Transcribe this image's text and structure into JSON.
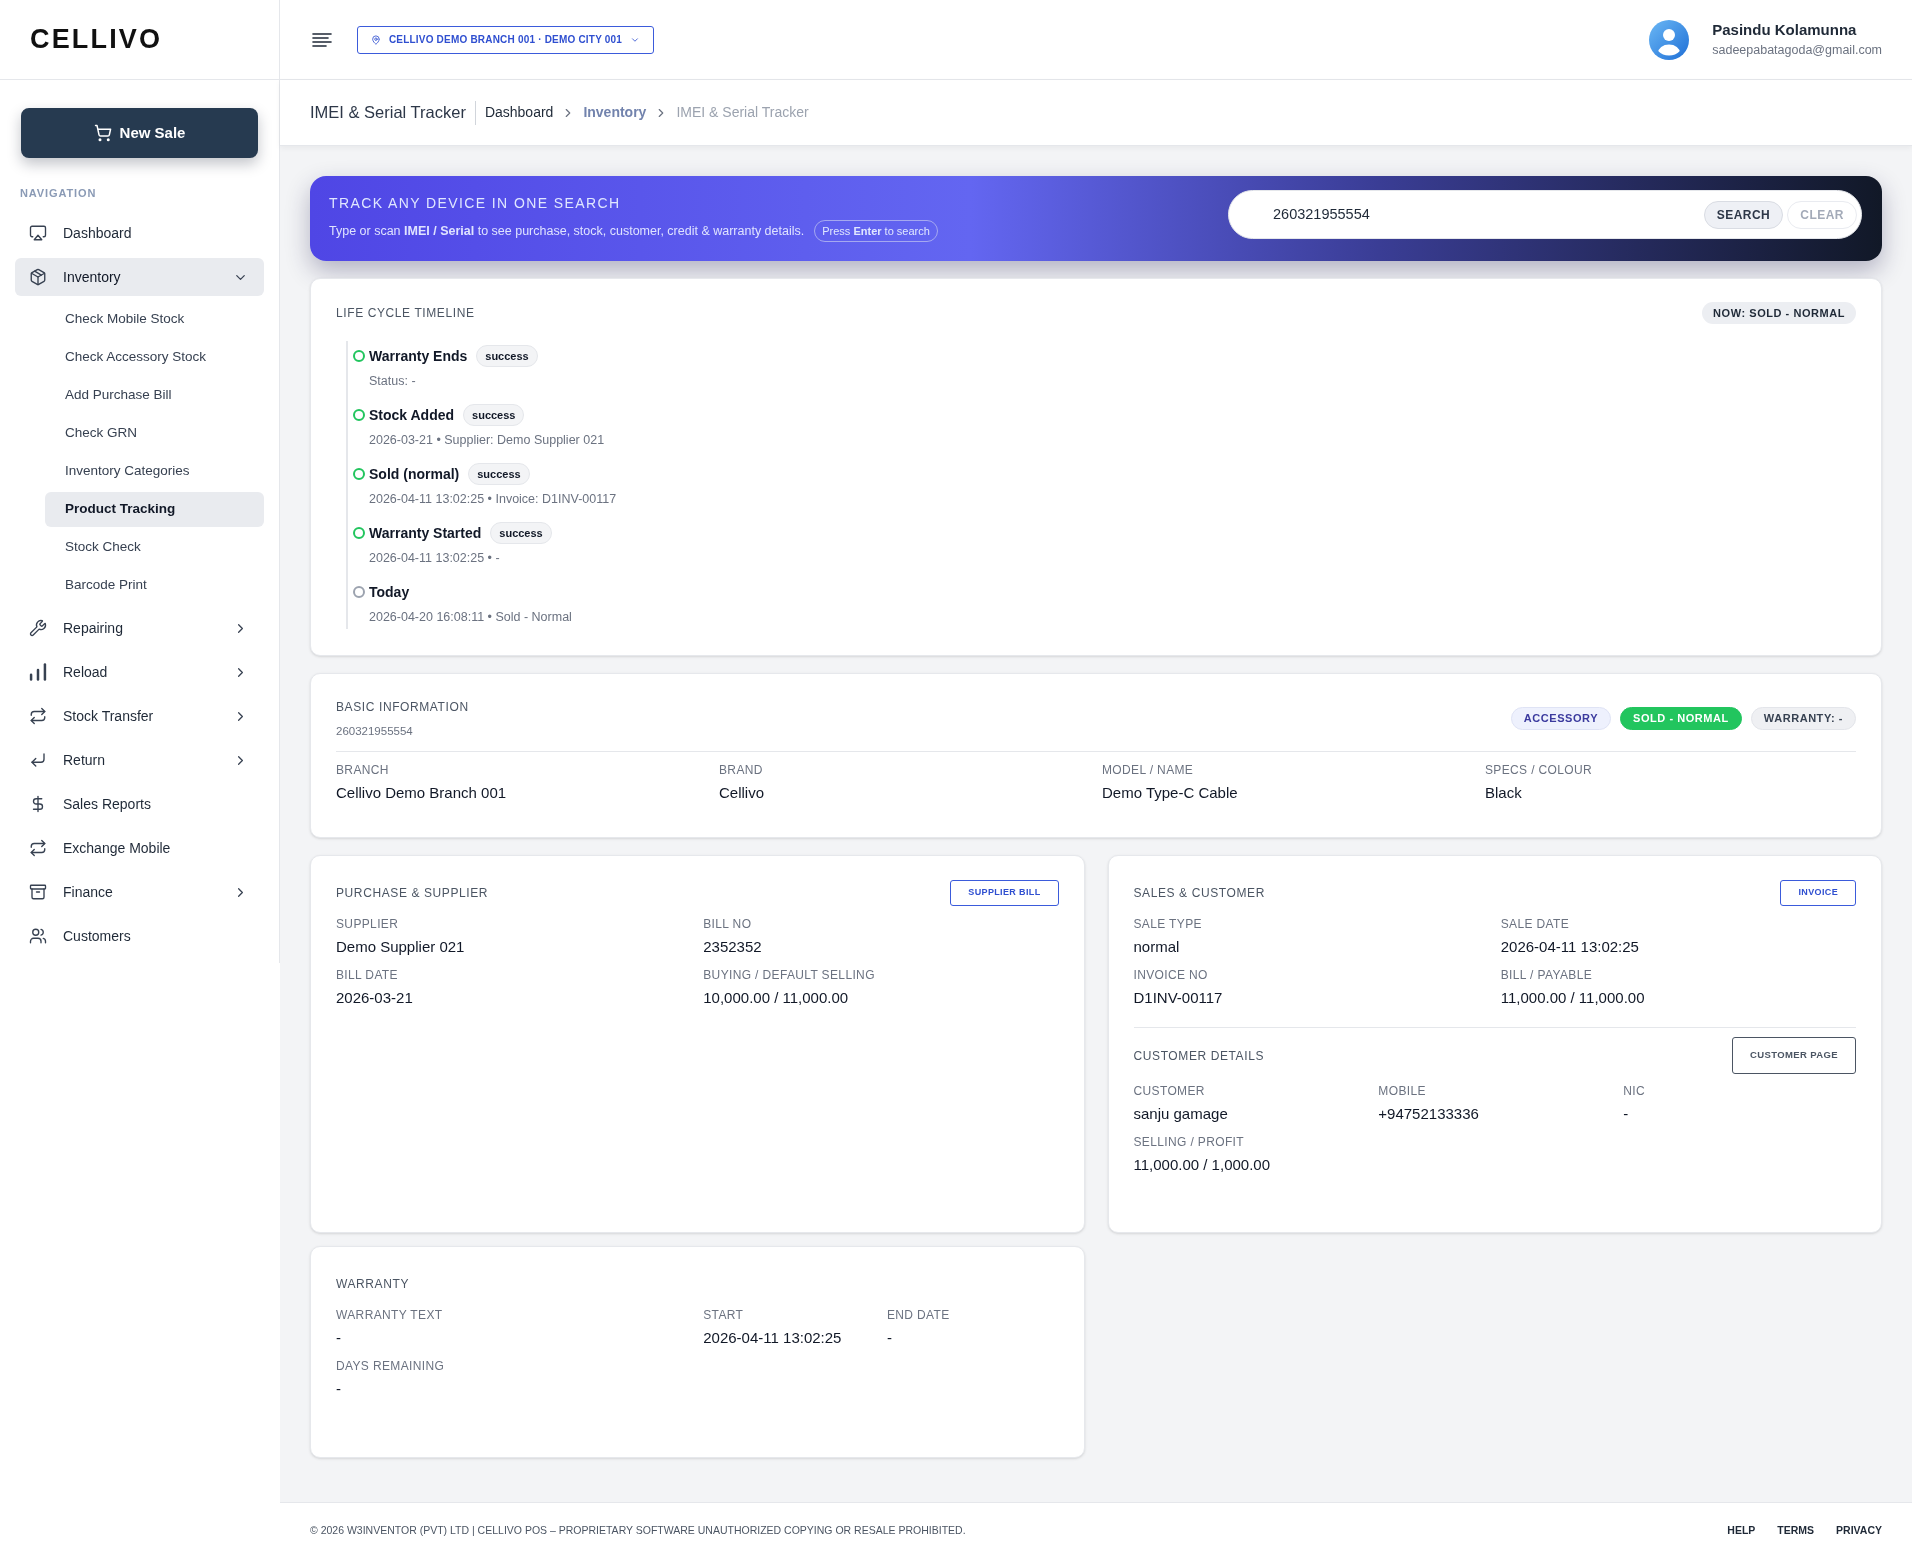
{
  "sidebar": {
    "logo": "CELLIVO",
    "new_sale": "New Sale",
    "section_label": "NAVIGATION",
    "items": [
      {
        "label": "Dashboard",
        "selected": false
      },
      {
        "label": "Inventory",
        "selected": true,
        "expanded": true,
        "children": [
          {
            "label": "Check Mobile Stock",
            "selected": false
          },
          {
            "label": "Check Accessory Stock",
            "selected": false
          },
          {
            "label": "Add Purchase Bill",
            "selected": false
          },
          {
            "label": "Check GRN",
            "selected": false
          },
          {
            "label": "Inventory Categories",
            "selected": false
          },
          {
            "label": "Product Tracking",
            "selected": true
          },
          {
            "label": "Stock Check",
            "selected": false
          },
          {
            "label": "Barcode Print",
            "selected": false
          }
        ]
      },
      {
        "label": "Repairing",
        "selected": false,
        "expanded": false
      },
      {
        "label": "Reload",
        "selected": false,
        "expanded": false
      },
      {
        "label": "Stock Transfer",
        "selected": false,
        "expanded": false
      },
      {
        "label": "Return",
        "selected": false,
        "expanded": false
      },
      {
        "label": "Sales Reports",
        "selected": false
      },
      {
        "label": "Exchange Mobile",
        "selected": false
      },
      {
        "label": "Finance",
        "selected": false,
        "expanded": false
      },
      {
        "label": "Customers",
        "selected": false
      }
    ]
  },
  "topbar": {
    "branch": "CELLIVO DEMO BRANCH 001 · DEMO CITY 001",
    "user": {
      "name": "Pasindu Kolamunna",
      "email": "sadeepabatagoda@gmail.com"
    }
  },
  "breadcrumb": {
    "title": "IMEI & Serial Tracker",
    "path": [
      "Dashboard",
      "Inventory",
      "IMEI & Serial Tracker"
    ]
  },
  "search_banner": {
    "title": "TRACK ANY DEVICE IN ONE SEARCH",
    "subtitle": "Type or scan **IMEI / Serial** to see purchase, stock, customer, credit & warranty details.",
    "hint": "Press **Enter** to search",
    "search": {
      "value": "260321955554"
    },
    "buttons": [
      {
        "label": "SEARCH",
        "disabled": false
      },
      {
        "label": "CLEAR",
        "disabled": true
      }
    ]
  },
  "timeline": {
    "title": "LIFE CYCLE TIMELINE",
    "now": "NOW: SOLD - NORMAL",
    "events": [
      {
        "title": "Warranty Ends",
        "badge": "success",
        "detail": "Status: -",
        "color": "#22c55e"
      },
      {
        "title": "Stock Added",
        "badge": "success",
        "detail": "2026-03-21 • Supplier: Demo Supplier 021",
        "color": "#22c55e"
      },
      {
        "title": "Sold (normal)",
        "badge": "success",
        "detail": "2026-04-11 13:02:25 • Invoice: D1INV-00117",
        "color": "#22c55e"
      },
      {
        "title": "Warranty Started",
        "badge": "success",
        "detail": "2026-04-11 13:02:25 • -",
        "color": "#22c55e"
      },
      {
        "title": "Today",
        "detail": "2026-04-20 16:08:11 • Sold - Normal",
        "color": "#9ca3af"
      }
    ]
  },
  "basic_info": {
    "title": "BASIC INFORMATION",
    "imei": "260321955554",
    "tags": [
      {
        "label": "ACCESSORY",
        "kind": "category"
      },
      {
        "label": "SOLD - NORMAL",
        "kind": "status"
      },
      {
        "label": "WARRANTY: -",
        "kind": "warranty"
      }
    ],
    "fields": [
      {
        "label": "BRANCH",
        "value": "Cellivo Demo Branch 001"
      },
      {
        "label": "BRAND",
        "value": "Cellivo"
      },
      {
        "label": "MODEL / NAME",
        "value": "Demo Type-C Cable"
      },
      {
        "label": "SPECS / COLOUR",
        "value": "Black"
      }
    ]
  },
  "purchase": {
    "title": "PURCHASE & SUPPLIER",
    "button": "SUPPLIER BILL",
    "fields": [
      {
        "label": "SUPPLIER",
        "value": "Demo Supplier 021"
      },
      {
        "label": "BILL NO",
        "value": "2352352"
      },
      {
        "label": "BILL DATE",
        "value": "2026-03-21"
      },
      {
        "label": "BUYING / DEFAULT SELLING",
        "value": "10,000.00 / 11,000.00"
      }
    ]
  },
  "sales": {
    "title": "SALES & CUSTOMER",
    "button": "INVOICE",
    "fields": [
      {
        "label": "SALE TYPE",
        "value": "normal"
      },
      {
        "label": "SALE DATE",
        "value": "2026-04-11 13:02:25"
      },
      {
        "label": "INVOICE NO",
        "value": "D1INV-00117"
      },
      {
        "label": "BILL / PAYABLE",
        "value": "11,000.00 / 11,000.00"
      }
    ],
    "customer": {
      "title": "CUSTOMER DETAILS",
      "button": "CUSTOMER PAGE",
      "fields": [
        {
          "label": "CUSTOMER",
          "value": "sanju gamage"
        },
        {
          "label": "MOBILE",
          "value": "+94752133336"
        },
        {
          "label": "NIC",
          "value": "-"
        },
        {
          "label": "SELLING / PROFIT",
          "value": "11,000.00 / 1,000.00"
        }
      ]
    }
  },
  "warranty": {
    "title": "WARRANTY",
    "fields": [
      {
        "label": "WARRANTY TEXT",
        "value": "-"
      },
      {
        "label": "START",
        "value": "2026-04-11 13:02:25"
      },
      {
        "label": "END DATE",
        "value": "-"
      },
      {
        "label": "DAYS REMAINING",
        "value": "-"
      }
    ]
  },
  "footer": {
    "copyright": "© 2026 W3INVENTOR (PVT) LTD | CELLIVO POS – PROPRIETARY SOFTWARE UNAUTHORIZED COPYING OR RESALE PROHIBITED.",
    "links": [
      "HELP",
      "TERMS",
      "PRIVACY"
    ]
  }
}
